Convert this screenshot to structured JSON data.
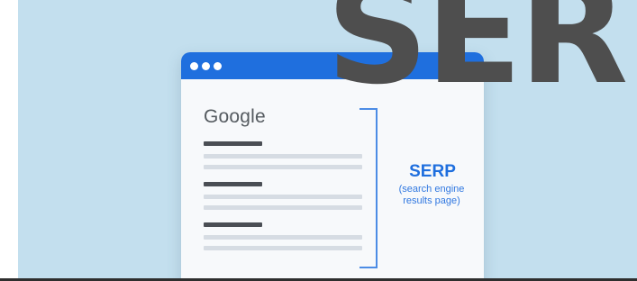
{
  "illustration": {
    "window_title_dots": 3,
    "brand_label": "Google",
    "callout": {
      "title": "SERP",
      "subtitle_line1": "(search engine",
      "subtitle_line2": "results page)"
    }
  },
  "overlay_text": "SER",
  "colors": {
    "background": "#c3dfee",
    "browser_bar": "#1f6fde",
    "accent": "#1f6fde",
    "overlay_text": "#4e4e4e"
  }
}
